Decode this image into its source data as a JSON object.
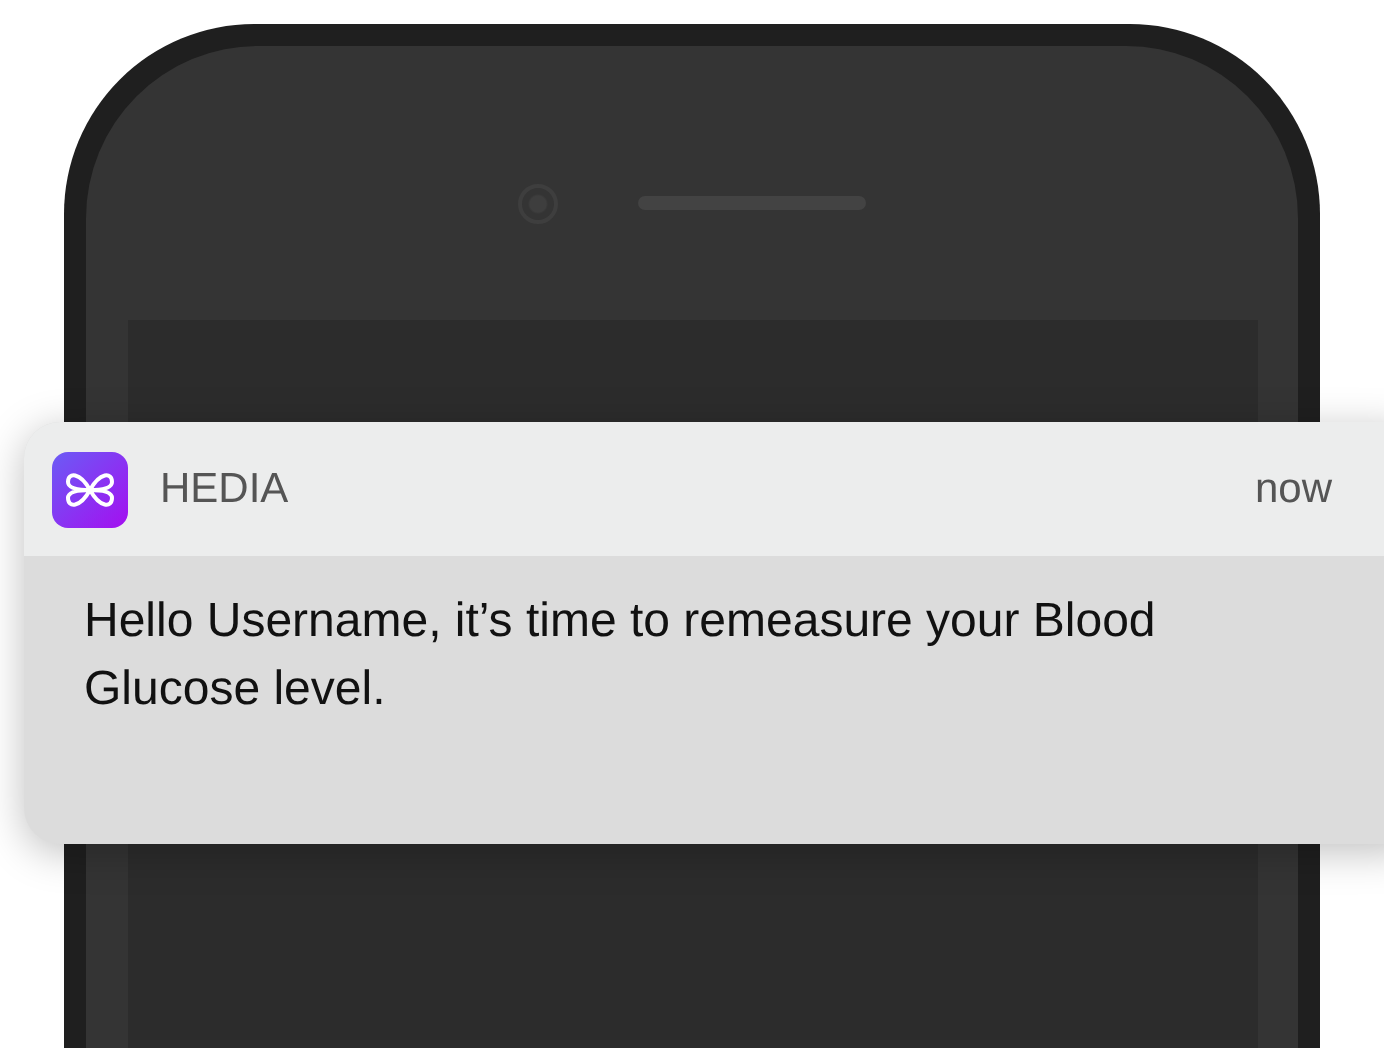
{
  "notification": {
    "app_name": "HEDIA",
    "time": "now",
    "message": "Hello Username, it’s time to remeasure your Blood Glucose level."
  }
}
